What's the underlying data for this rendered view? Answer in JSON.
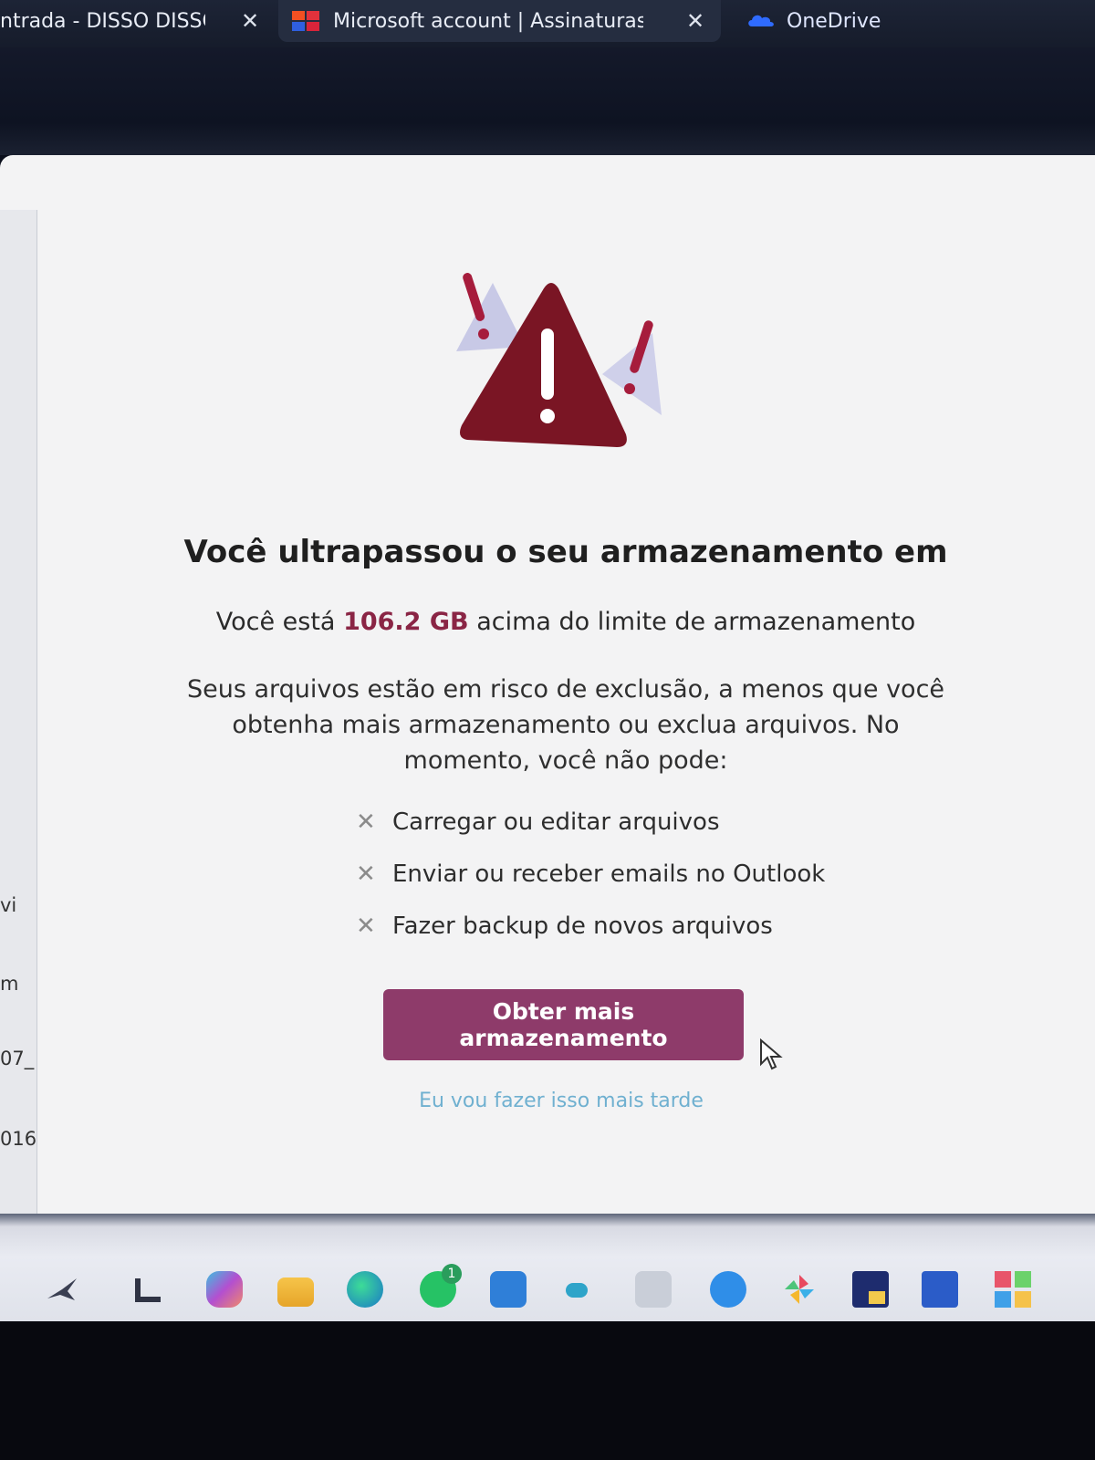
{
  "browser": {
    "tabs": [
      {
        "label": "ntrada - DISSO DISSC",
        "close": "✕"
      },
      {
        "label": "Microsoft account | Assinaturas",
        "close": "✕"
      },
      {
        "label": "OneDrive"
      }
    ]
  },
  "dialog": {
    "title": "Você ultrapassou o seu armazenamento em",
    "over_limit_prefix": "Você está",
    "over_limit_amount": "106.2 GB",
    "over_limit_suffix": "acima do limite de armazenamento",
    "description": "Seus arquivos estão em risco de exclusão, a menos que você obtenha mais armazenamento ou exclua arquivos. No momento, você não pode:",
    "restrictions": [
      "Carregar ou editar arquivos",
      "Enviar ou receber emails no Outlook",
      "Fazer backup de novos arquivos"
    ],
    "restriction_mark": "✕",
    "primary_button": "Obter mais armazenamento",
    "secondary_link": "Eu vou fazer isso mais tarde"
  },
  "left_fragments": [
    "vi",
    "m",
    "07_",
    "016"
  ],
  "colors": {
    "accent_button": "#8e3b6a",
    "warning_dark": "#7a1524",
    "amount_text": "#8a2545",
    "link": "#6fb0d0"
  },
  "taskbar": {
    "icons": [
      "pinned-app-icon",
      "file-manager-icon",
      "copilot-icon",
      "folder-icon",
      "edge-icon",
      "whatsapp-icon",
      "store-icon",
      "cloud-app-icon",
      "bank-app-icon",
      "zoom-icon",
      "pinwheel-app-icon",
      "sticky-notes-icon",
      "word-icon",
      "office-icon"
    ],
    "whatsapp_badge": "1"
  }
}
